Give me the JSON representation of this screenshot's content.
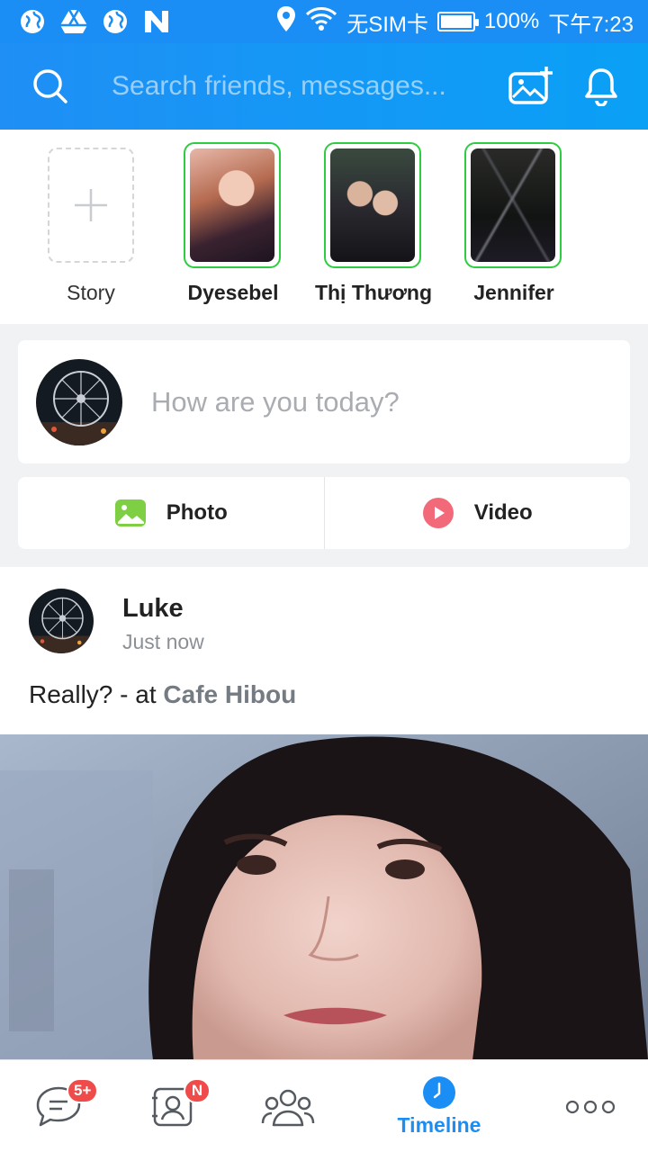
{
  "status_bar": {
    "carrier": "无SIM卡",
    "battery": "100%",
    "time": "下午7:23"
  },
  "header": {
    "search_placeholder": "Search friends, messages..."
  },
  "stories": [
    {
      "name": "Story",
      "type": "add"
    },
    {
      "name": "Dyesebel",
      "type": "friend"
    },
    {
      "name": "Thị Thương",
      "type": "friend"
    },
    {
      "name": "Jennifer",
      "type": "friend"
    }
  ],
  "composer": {
    "placeholder": "How are you today?",
    "photo_label": "Photo",
    "video_label": "Video"
  },
  "post": {
    "author": "Luke",
    "time": "Just now",
    "text": "Really? - at ",
    "place": "Cafe Hibou"
  },
  "bottom_nav": {
    "messages_badge": "5+",
    "contacts_badge": "N",
    "timeline_label": "Timeline"
  },
  "colors": {
    "brand": "#1a8ef5",
    "story_ring": "#2ecc40",
    "badge": "#f04b4b"
  }
}
